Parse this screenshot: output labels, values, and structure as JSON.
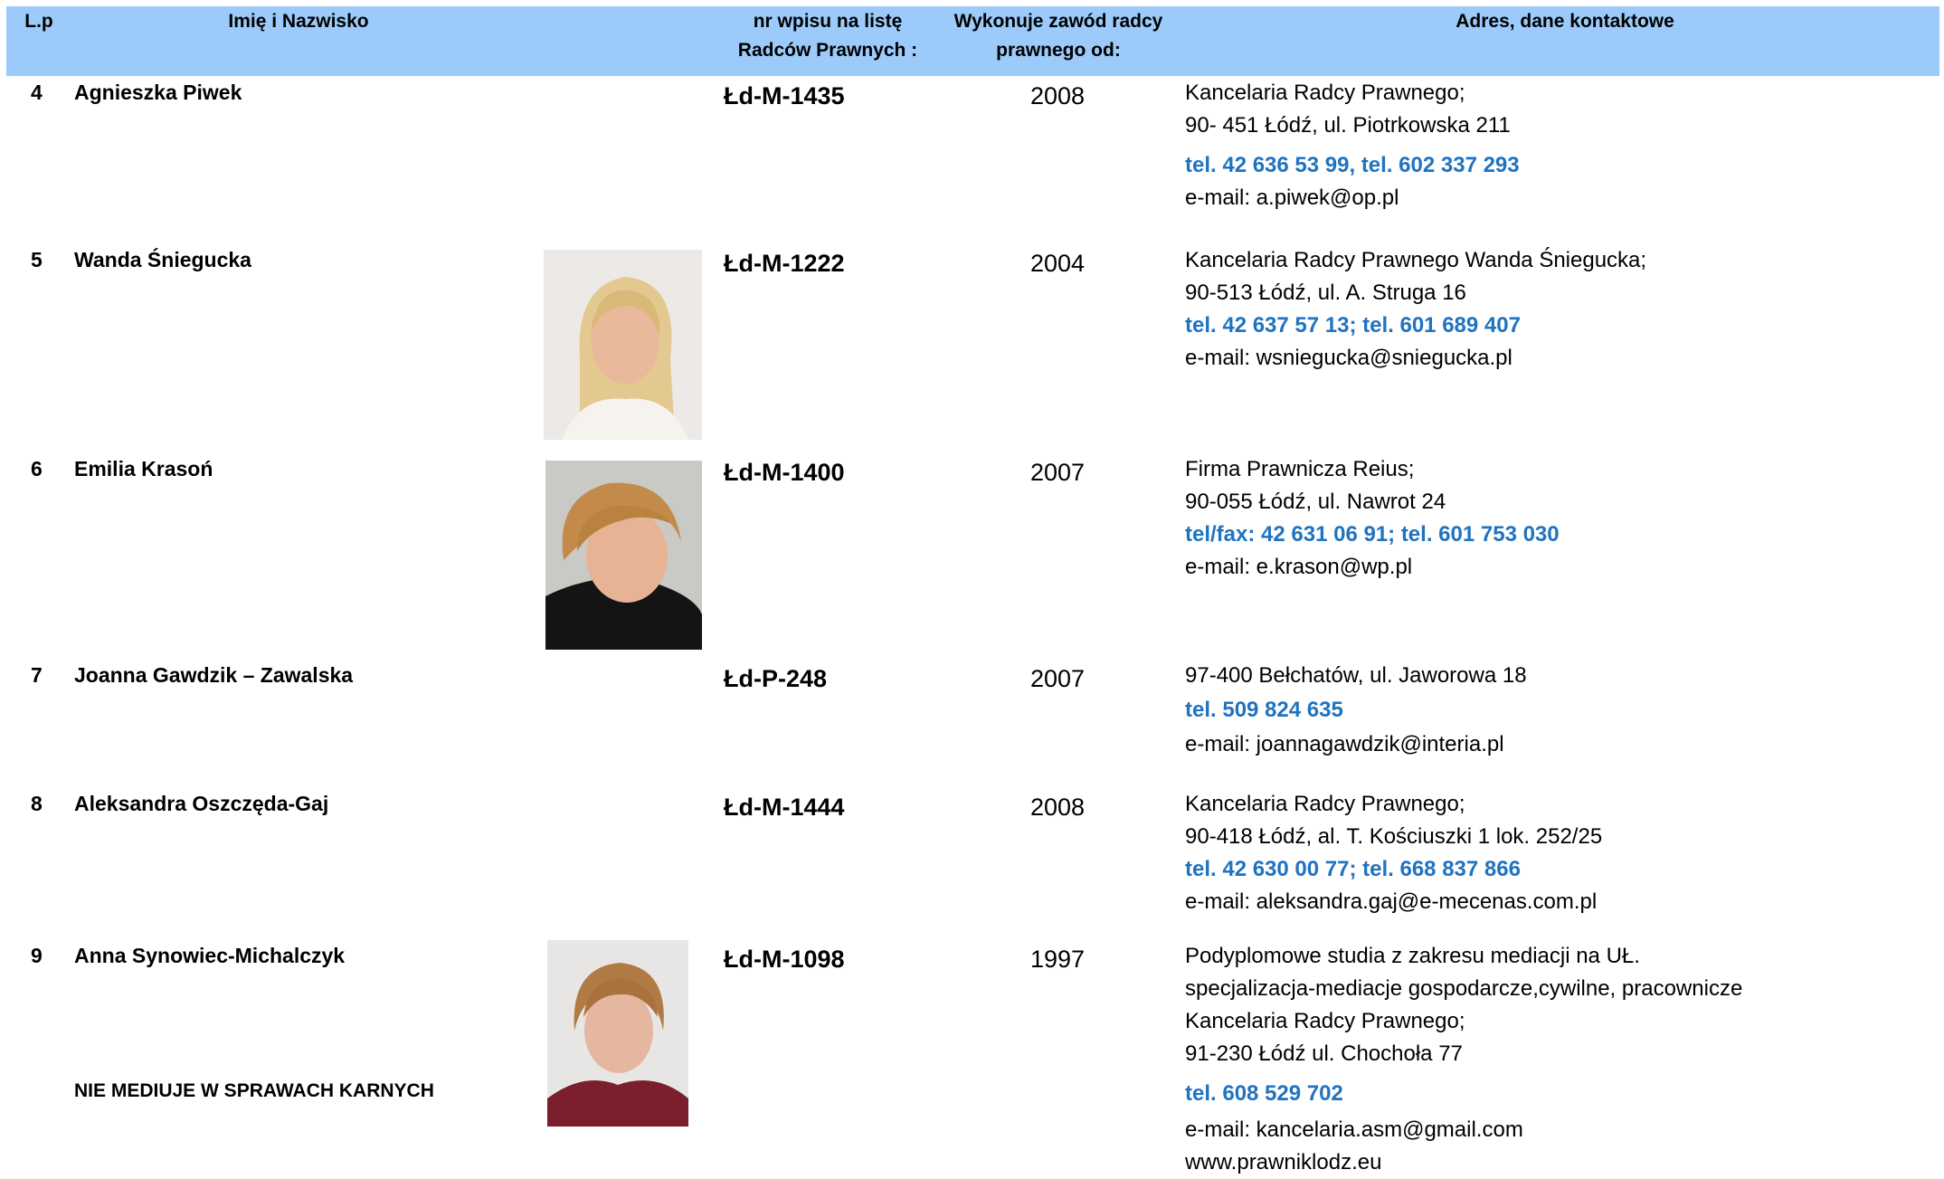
{
  "header": {
    "lp": "L.p",
    "name": "Imię i Nazwisko",
    "nr_line1": "nr wpisu na listę",
    "nr_line2": "Radców Prawnych :",
    "since_line1": "Wykonuje zawód radcy",
    "since_line2": "prawnego od:",
    "contact": "Adres, dane kontaktowe"
  },
  "rows": [
    {
      "lp": "4",
      "name": "Agnieszka Piwek",
      "nr": "Łd-M-1435",
      "year": "2008",
      "lines": [
        "Kancelaria Radcy Prawnego;",
        "90- 451 Łódź, ul. Piotrkowska 211",
        "tel. 42 636 53 99, tel.  602 337 293",
        "e-mail: a.piwek@op.pl"
      ]
    },
    {
      "lp": "5",
      "name": "Wanda Śniegucka",
      "nr": "Łd-M-1222",
      "year": "2004",
      "lines": [
        "Kancelaria Radcy Prawnego Wanda Śniegucka;",
        "90-513 Łódź, ul. A. Struga 16",
        "tel. 42 637 57 13; tel. 601 689 407",
        "e-mail: wsniegucka@sniegucka.pl"
      ]
    },
    {
      "lp": "6",
      "name": "Emilia Krasoń",
      "nr": "Łd-M-1400",
      "year": "2007",
      "lines": [
        "Firma Prawnicza Reius;",
        "90-055 Łódź, ul. Nawrot 24",
        "tel/fax: 42 631 06 91; tel. 601 753 030",
        "e-mail: e.krason@wp.pl"
      ]
    },
    {
      "lp": "7",
      "name": "Joanna Gawdzik – Zawalska",
      "nr": "Łd-P-248",
      "year": "2007",
      "lines": [
        "97-400 Bełchatów, ul. Jaworowa 18",
        "tel.  509 824 635",
        "e-mail: joannagawdzik@interia.pl"
      ]
    },
    {
      "lp": "8",
      "name": "Aleksandra Oszczęda-Gaj",
      "nr": "Łd-M-1444",
      "year": "2008",
      "lines": [
        "Kancelaria Radcy Prawnego;",
        "90-418 Łódź, al. T. Kościuszki 1 lok. 252/25",
        "tel. 42 630 00 77; tel. 668 837 866",
        "e-mail: aleksandra.gaj@e-mecenas.com.pl"
      ]
    },
    {
      "lp": "9",
      "name": "Anna Synowiec-Michalczyk",
      "note": "NIE MEDIUJE W SPRAWACH KARNYCH",
      "nr": "Łd-M-1098",
      "year": "1997",
      "lines": [
        "Podyplomowe studia z zakresu mediacji na UŁ.",
        "specjalizacja-mediacje gospodarcze,cywilne, pracownicze",
        "Kancelaria Radcy Prawnego;",
        "91-230 Łódź ul. Chochoła 77",
        "tel. 608 529 702",
        "e-mail: kancelaria.asm@gmail.com",
        "www.prawniklodz.eu"
      ]
    }
  ],
  "colors": {
    "header_bg": "#9ccbfb",
    "phone_text": "#1f73c0"
  }
}
